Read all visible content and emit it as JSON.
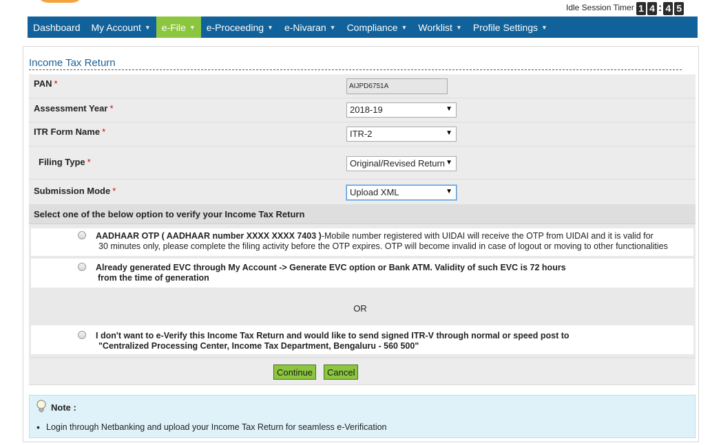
{
  "header": {
    "idle_label": "Idle Session Timer",
    "timer_digits": [
      "1",
      "4",
      "4",
      "5"
    ]
  },
  "nav": {
    "items": [
      {
        "label": "Dashboard",
        "dropdown": false,
        "active": false
      },
      {
        "label": "My Account",
        "dropdown": true,
        "active": false
      },
      {
        "label": "e-File",
        "dropdown": true,
        "active": true
      },
      {
        "label": "e-Proceeding",
        "dropdown": true,
        "active": false
      },
      {
        "label": "e-Nivaran",
        "dropdown": true,
        "active": false
      },
      {
        "label": "Compliance",
        "dropdown": true,
        "active": false
      },
      {
        "label": "Worklist",
        "dropdown": true,
        "active": false
      },
      {
        "label": "Profile Settings",
        "dropdown": true,
        "active": false
      }
    ],
    "bg_color": "#11629a",
    "active_color": "#8cc63f"
  },
  "form": {
    "title": "Income Tax Return",
    "pan": {
      "label": "PAN",
      "required": "*",
      "value": "AIJPD6751A"
    },
    "assessment_year": {
      "label": "Assessment Year",
      "required": "*",
      "value": "2018-19"
    },
    "itr_form": {
      "label": "ITR Form Name",
      "required": "*",
      "value": "ITR-2"
    },
    "filing_type": {
      "label": "Filing Type",
      "required": "*",
      "value": "Original/Revised Return"
    },
    "submission_mode": {
      "label": "Submission Mode",
      "required": "*",
      "value": "Upload XML"
    }
  },
  "verify": {
    "heading": "Select one of the below option to verify your Income Tax Return",
    "option1": {
      "bold": "AADHAAR OTP ( AADHAAR number XXXX XXXX 7403 )",
      "text": "-Mobile number registered with UIDAI will receive the OTP from UIDAI and it is valid for",
      "text2": "30 minutes only, please complete the filing activity before the OTP expires. OTP will become invalid in case of logout or moving to other functionalities"
    },
    "option2": {
      "line1": "Already generated EVC through My Account -> Generate EVC option or Bank ATM. Validity of such EVC is 72 hours",
      "line2": "from the time of generation"
    },
    "or_text": "OR",
    "option3": {
      "line1": "I don't want to e-Verify this Income Tax Return and would like to send signed ITR-V through normal or speed post to",
      "line2": "\"Centralized Processing Center, Income Tax Department, Bengaluru - 560 500\""
    }
  },
  "buttons": {
    "continue": "Continue",
    "cancel": "Cancel"
  },
  "note": {
    "title": "Note :",
    "items": [
      "Login through Netbanking and upload your Income Tax Return for seamless e-Verification"
    ]
  }
}
